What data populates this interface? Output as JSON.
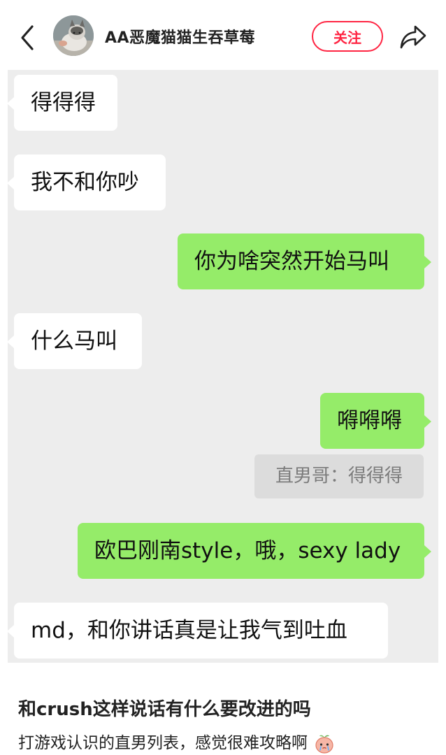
{
  "header": {
    "username": "AA恶魔猫猫生吞草莓",
    "follow_label": "关注",
    "icons": [
      "back-arrow-icon",
      "cat-avatar",
      "share-icon"
    ]
  },
  "messages": [
    {
      "side": "in",
      "text": "得得得"
    },
    {
      "side": "in",
      "text": "我不和你吵"
    },
    {
      "side": "out",
      "text": "你为啥突然开始马叫"
    },
    {
      "side": "in",
      "text": "什么马叫"
    },
    {
      "side": "out",
      "text": "嘚嘚嘚"
    },
    {
      "side": "out",
      "text": "欧巴刚南style，哦，sexy lady"
    },
    {
      "side": "in",
      "text": "md，和你讲话真是让我气到吐血"
    }
  ],
  "quote": {
    "text": "直男哥：得得得"
  },
  "post": {
    "title": "和crush这样说话有什么要改进的吗",
    "body": "打游戏认识的直男列表，感觉很难攻略啊",
    "emoji": "crying-peach-emoji-icon"
  },
  "colors": {
    "accent": "#ff2442",
    "bubble_out": "#95ec69",
    "bubble_in": "#ffffff",
    "chat_bg": "#ededed"
  }
}
